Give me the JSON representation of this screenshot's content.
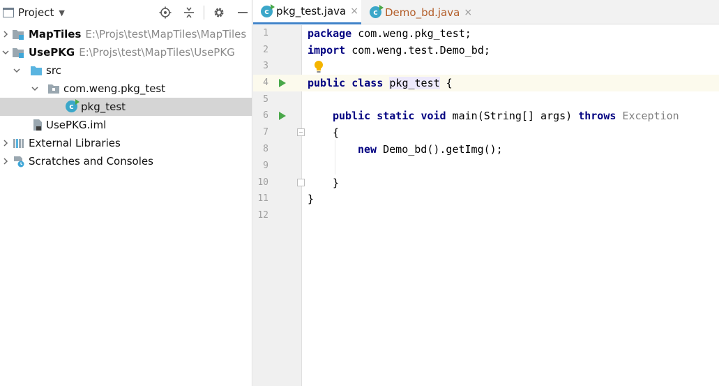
{
  "project_panel": {
    "title": "Project",
    "tools": [
      "locate-icon",
      "collapse-icon",
      "gear-icon",
      "minimize-icon"
    ],
    "tree": [
      {
        "label": "MapTiles",
        "path": "E:\\Projs\\test\\MapTiles\\MapTiles",
        "bold": true,
        "icon": "module-folder-icon"
      },
      {
        "label": "UsePKG",
        "path": "E:\\Projs\\test\\MapTiles\\UsePKG",
        "bold": true,
        "icon": "module-folder-icon"
      },
      {
        "label": "src",
        "icon": "source-folder-icon"
      },
      {
        "label": "com.weng.pkg_test",
        "icon": "package-icon"
      },
      {
        "label": "pkg_test",
        "icon": "java-class-icon"
      },
      {
        "label": "UsePKG.iml",
        "icon": "iml-file-icon"
      },
      {
        "label": "External Libraries",
        "icon": "libraries-icon"
      },
      {
        "label": "Scratches and Consoles",
        "icon": "scratches-icon"
      }
    ]
  },
  "editor": {
    "tabs": [
      {
        "label": "pkg_test.java",
        "active": true
      },
      {
        "label": "Demo_bd.java",
        "active": false
      }
    ],
    "close_glyph": "×",
    "line_numbers": [
      "1",
      "2",
      "3",
      "4",
      "5",
      "6",
      "7",
      "8",
      "9",
      "10",
      "11",
      "12"
    ],
    "code": {
      "l1_kw": "package",
      "l1_rest": " com.weng.pkg_test;",
      "l2_kw": "import",
      "l2_rest": " com.weng.test.Demo_bd;",
      "l4_kw1": "public",
      "l4_kw2": "class",
      "l4_ident": "pkg_test",
      "l4_rest": " {",
      "l6_kw1": "public",
      "l6_kw2": "static",
      "l6_kw3": "void",
      "l6_mid": " main(String[] args) ",
      "l6_kw4": "throws",
      "l6_exc": " Exception",
      "l7": "{",
      "l8_kw": "new",
      "l8_rest": " Demo_bd().getImg();",
      "l10": "}",
      "l11": "}"
    }
  },
  "colors": {
    "keyword": "#000080",
    "selection": "#d5d5d5",
    "active_tab_underline": "#4083c9",
    "current_line": "#fcfaed",
    "run_green": "#4aa84a",
    "java_icon": "#3ba7c9"
  }
}
